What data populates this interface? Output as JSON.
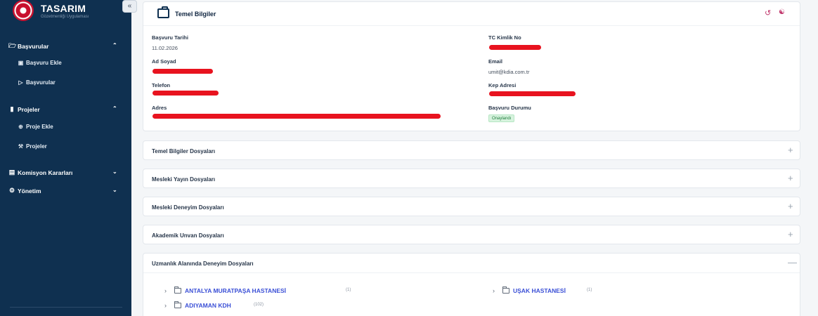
{
  "sidebar": {
    "brand_title": "TASARIM",
    "brand_subtitle": "Gözetmenliği Uygulaması",
    "collapse_label": "«",
    "groups": [
      {
        "label": "Başvurular",
        "icon": "folder-open-icon",
        "chevron": "^"
      },
      {
        "label": "Projeler",
        "icon": "columns-icon",
        "chevron": "^"
      },
      {
        "label": "Komisyon Kararları",
        "icon": "document-icon",
        "chevron": "v"
      },
      {
        "label": "Yönetim",
        "icon": "gear-icon",
        "chevron": "v"
      }
    ],
    "sub_items": {
      "basvuru_ekle": "Başvuru Ekle",
      "basvurular": "Başvurular",
      "proje_ekle": "Proje Ekle",
      "projeler": "Projeler"
    }
  },
  "info_card": {
    "title": "Temel Bilgiler",
    "fields": {
      "basvuru_tarihi_label": "Başvuru Tarihi",
      "basvuru_tarihi_value": "11.02.2026",
      "tc_kimlik_label": "TC Kimlik No",
      "ad_soyad_label": "Ad Soyad",
      "email_label": "Email",
      "email_value": "umit@kdia.com.tr",
      "telefon_label": "Telefon",
      "kep_label": "Kep Adresi",
      "adres_label": "Adres",
      "durum_label": "Başvuru Durumu",
      "durum_value": "Onaylandı"
    }
  },
  "panels": [
    {
      "title": "Temel Bilgiler Dosyaları",
      "toggle": "+"
    },
    {
      "title": "Mesleki Yayın Dosyaları",
      "toggle": "+"
    },
    {
      "title": "Mesleki Deneyim Dosyaları",
      "toggle": "+"
    },
    {
      "title": "Akademik Unvan Dosyaları",
      "toggle": "+"
    }
  ],
  "open_panel": {
    "title": "Uzmanlık Alanında Deneyim Dosyaları",
    "toggle": "—",
    "folders": [
      {
        "name": "ANTALYA MURATPAŞA HASTANESİ",
        "count": "(1)"
      },
      {
        "name": "UŞAK HASTANESİ",
        "count": "(1)"
      },
      {
        "name": "ADIYAMAN KDH",
        "count": "(102)"
      }
    ]
  },
  "colors": {
    "sidebar_bg": "#0f3050",
    "accent_link": "#3a4fd6",
    "status_green": "#1d7a3a",
    "redaction": "#e8131f"
  }
}
